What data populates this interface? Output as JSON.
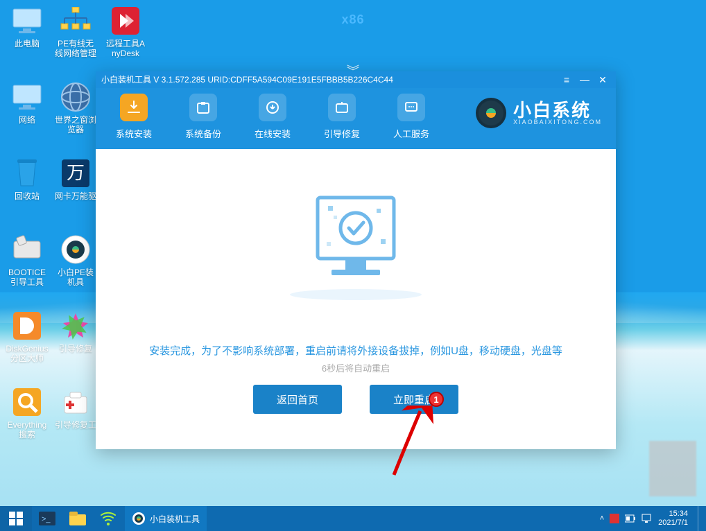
{
  "arch_label": "x86",
  "desktop_icons": [
    {
      "id": "this-pc",
      "label": "此电脑"
    },
    {
      "id": "pe-net",
      "label": "PE有线无线网络管理"
    },
    {
      "id": "anydesk",
      "label": "远程工具AnyDesk"
    },
    {
      "id": "network",
      "label": "网络"
    },
    {
      "id": "world-browser",
      "label": "世界之窗浏览器"
    },
    {
      "id": "recycle-bin",
      "label": "回收站"
    },
    {
      "id": "netcard",
      "label": "网卡万能驱"
    },
    {
      "id": "bootice",
      "label": "BOOTICE引导工具"
    },
    {
      "id": "xiaobai-pe",
      "label": "小白PE装机具"
    },
    {
      "id": "diskgenius",
      "label": "DiskGenius分区大师"
    },
    {
      "id": "boot-repair",
      "label": "引导修复"
    },
    {
      "id": "everything",
      "label": "Everything搜索"
    },
    {
      "id": "boot-repair-tool",
      "label": "引导修复工"
    }
  ],
  "window": {
    "title": "小白装机工具 V 3.1.572.285 URID:CDFF5A594C09E191E5FBBB5B226C4C44",
    "tabs": [
      "系统安装",
      "系统备份",
      "在线安装",
      "引导修复",
      "人工服务"
    ],
    "brand_big": "小白系统",
    "brand_small": "XIAOBAIXITONG.COM",
    "message": "安装完成，为了不影响系统部署，重启前请将外接设备拔掉，例如U盘，移动硬盘，光盘等",
    "sub": "6秒后将自动重启",
    "btn_back": "返回首页",
    "btn_restart": "立即重启",
    "badge": "1"
  },
  "taskbar": {
    "app": "小白装机工具",
    "time": "15:34",
    "date": "2021/7/1"
  }
}
